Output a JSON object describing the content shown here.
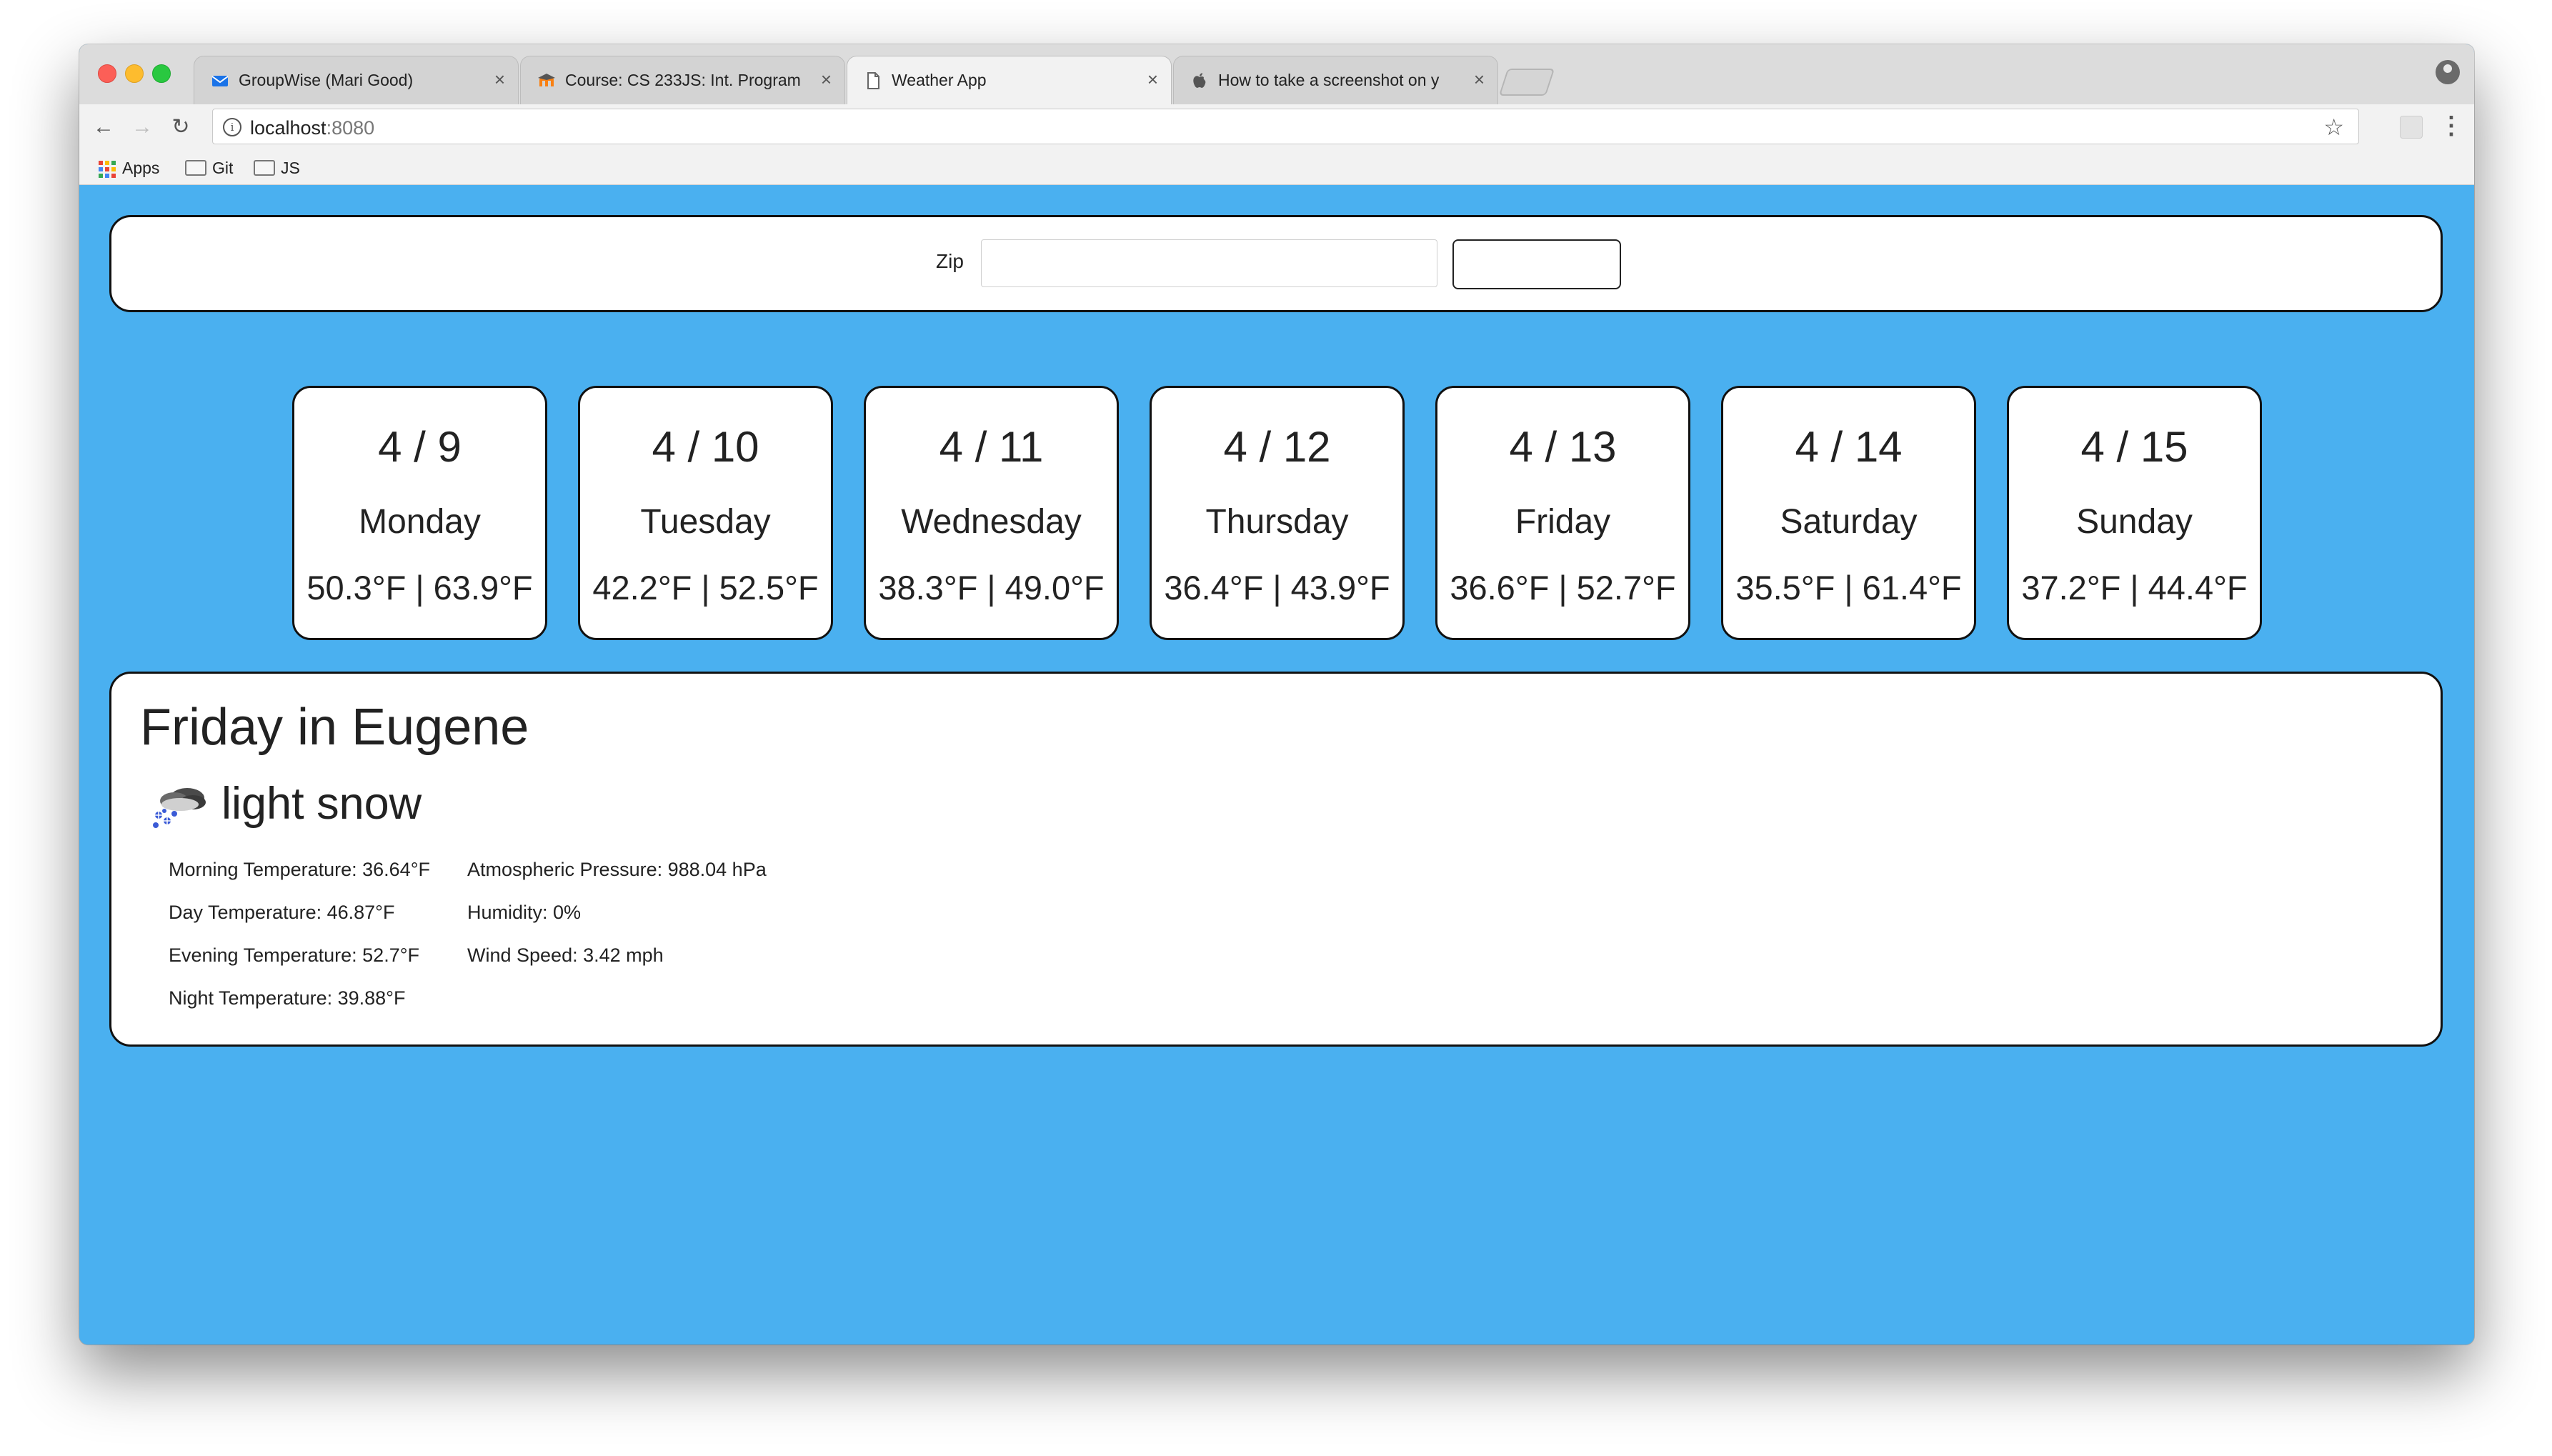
{
  "browser": {
    "tabs": [
      {
        "label": "GroupWise (Mari Good)",
        "icon": "mail-icon",
        "active": false
      },
      {
        "label": "Course: CS 233JS: Int. Program",
        "icon": "moodle-icon",
        "active": false
      },
      {
        "label": "Weather App",
        "icon": "document-icon",
        "active": true
      },
      {
        "label": "How to take a screenshot on y",
        "icon": "apple-icon",
        "active": false
      }
    ],
    "close_glyph": "×",
    "url_host": "localhost",
    "url_port": ":8080",
    "bookmarks": [
      {
        "label": "Apps",
        "icon": "apps-grid-icon"
      },
      {
        "label": "Git",
        "icon": "folder-icon"
      },
      {
        "label": "JS",
        "icon": "folder-icon"
      }
    ]
  },
  "zip_form": {
    "label": "Zip",
    "input_value": "",
    "button_label": ""
  },
  "forecast": [
    {
      "date": "4 / 9",
      "day": "Monday",
      "temps": "50.3°F | 63.9°F"
    },
    {
      "date": "4 / 10",
      "day": "Tuesday",
      "temps": "42.2°F | 52.5°F"
    },
    {
      "date": "4 / 11",
      "day": "Wednesday",
      "temps": "38.3°F | 49.0°F"
    },
    {
      "date": "4 / 12",
      "day": "Thursday",
      "temps": "36.4°F | 43.9°F"
    },
    {
      "date": "4 / 13",
      "day": "Friday",
      "temps": "36.6°F | 52.7°F"
    },
    {
      "date": "4 / 14",
      "day": "Saturday",
      "temps": "35.5°F | 61.4°F"
    },
    {
      "date": "4 / 15",
      "day": "Sunday",
      "temps": "37.2°F | 44.4°F"
    }
  ],
  "detail": {
    "title": "Friday in Eugene",
    "condition": "light snow",
    "condition_icon": "snow-cloud-icon",
    "left_stats": [
      "Morning Temperature: 36.64°F",
      "Day Temperature: 46.87°F",
      "Evening Temperature: 52.7°F",
      "Night Temperature: 39.88°F"
    ],
    "right_stats": [
      "Atmospheric Pressure: 988.04 hPa",
      "Humidity: 0%",
      "Wind Speed: 3.42 mph"
    ]
  },
  "colors": {
    "page_background": "#4ab0f0",
    "card_border": "#111111"
  }
}
